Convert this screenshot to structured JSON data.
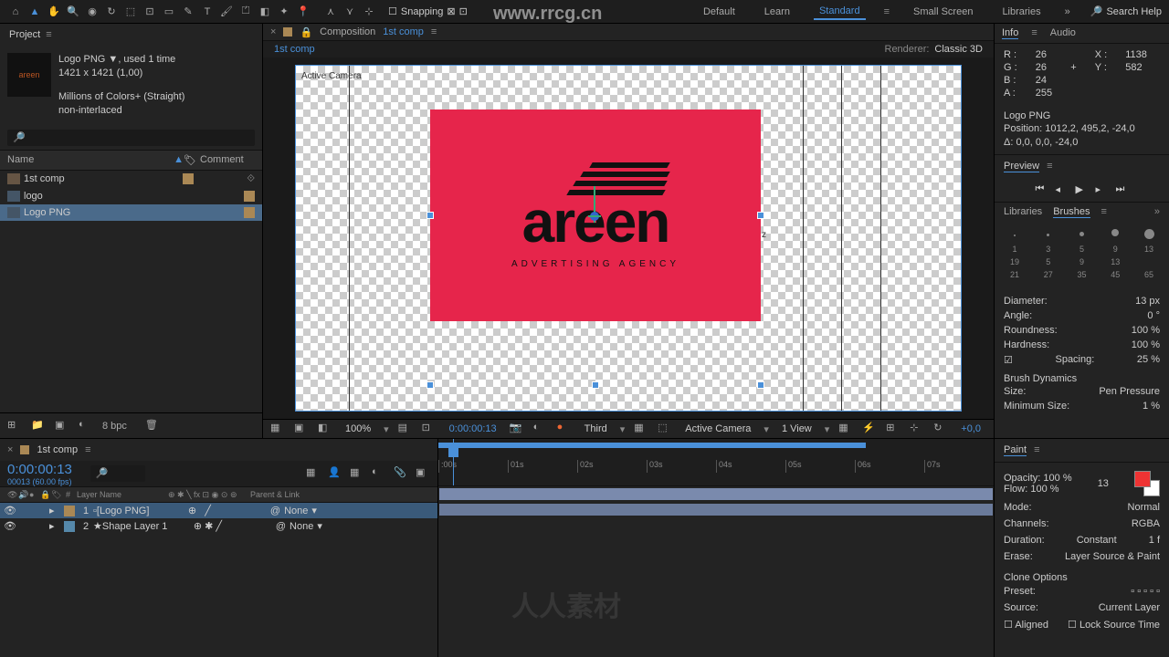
{
  "toolbar": {
    "snapping_label": "Snapping",
    "workspaces": [
      "Default",
      "Learn",
      "Standard",
      "Small Screen",
      "Libraries"
    ],
    "active_workspace": 2,
    "search_placeholder": "Search Help"
  },
  "project": {
    "panel_title": "Project",
    "asset": {
      "name": "Logo PNG ▼",
      "used": ", used 1 time",
      "dims": "1421 x 1421 (1,00)",
      "colors": "Millions of Colors+ (Straight)",
      "interlace": "non-interlaced"
    },
    "search_icon": "🔎",
    "columns": {
      "name": "Name",
      "comment": "Comment"
    },
    "items": [
      {
        "name": "1st comp",
        "type": "comp"
      },
      {
        "name": "logo",
        "type": "footage"
      },
      {
        "name": "Logo PNG",
        "type": "footage",
        "selected": true
      }
    ],
    "footer_bpc": "8 bpc"
  },
  "composition": {
    "tab_label": "Composition",
    "comp_name": "1st comp",
    "sub_name": "1st comp",
    "renderer_label": "Renderer:",
    "renderer_value": "Classic 3D",
    "camera_label": "Active Camera",
    "logo": {
      "text": "areen",
      "sub": "ADVERTISING AGENCY"
    },
    "footer": {
      "zoom": "100%",
      "time": "0:00:00:13",
      "res": "Third",
      "camera": "Active Camera",
      "view": "1 View",
      "exposure": "+0,0"
    }
  },
  "info": {
    "tabs": [
      "Info",
      "Audio"
    ],
    "R": "26",
    "G": "26",
    "B": "24",
    "A": "255",
    "X": "1138",
    "Y": "582",
    "layer_name": "Logo PNG",
    "position": "Position: 1012,2, 495,2, -24,0",
    "delta": "Δ: 0,0, 0,0, -24,0"
  },
  "preview": {
    "title": "Preview"
  },
  "brushes": {
    "tabs": [
      "Libraries",
      "Brushes"
    ],
    "sizes_r1": [
      "1",
      "3",
      "5",
      "9",
      "13"
    ],
    "sizes_r2": [
      "19",
      "5",
      "9",
      "13",
      ""
    ],
    "sizes_r3": [
      "21",
      "27",
      "35",
      "45",
      "65"
    ],
    "diameter_label": "Diameter:",
    "diameter": "13 px",
    "angle_label": "Angle:",
    "angle": "0 °",
    "roundness_label": "Roundness:",
    "roundness": "100 %",
    "hardness_label": "Hardness:",
    "hardness": "100 %",
    "spacing_label": "Spacing:",
    "spacing": "25 %",
    "dynamics": "Brush Dynamics",
    "size_label": "Size:",
    "size_val": "Pen Pressure",
    "min_label": "Minimum Size:",
    "min_val": "1 %"
  },
  "timeline": {
    "tab": "1st comp",
    "timecode": "0:00:00:13",
    "frames": "00013 (60.00 fps)",
    "cols": {
      "layer": "Layer Name",
      "parent": "Parent & Link"
    },
    "layers": [
      {
        "num": "1",
        "name": "[Logo PNG]",
        "parent": "None",
        "selected": true
      },
      {
        "num": "2",
        "name": "Shape Layer 1",
        "parent": "None",
        "star": "★"
      }
    ],
    "ticks": [
      ":00s",
      "01s",
      "02s",
      "03s",
      "04s",
      "05s",
      "06s",
      "07s"
    ]
  },
  "paint": {
    "title": "Paint",
    "opacity_label": "Opacity:",
    "opacity": "100 %",
    "flow_label": "Flow:",
    "flow": "100 %",
    "mode_label": "Mode:",
    "mode": "Normal",
    "channels_label": "Channels:",
    "channels": "RGBA",
    "duration_label": "Duration:",
    "duration": "Constant",
    "duration_f": "1 f",
    "erase_label": "Erase:",
    "erase": "Layer Source & Paint",
    "clone_title": "Clone Options",
    "preset_label": "Preset:",
    "source_label": "Source:",
    "source": "Current Layer",
    "aligned": "Aligned",
    "lock": "Lock Source Time",
    "swatch_num": "13"
  },
  "watermark": {
    "url": "www.rrcg.cn",
    "text1": "人人素材",
    "text2": "人人素材"
  }
}
